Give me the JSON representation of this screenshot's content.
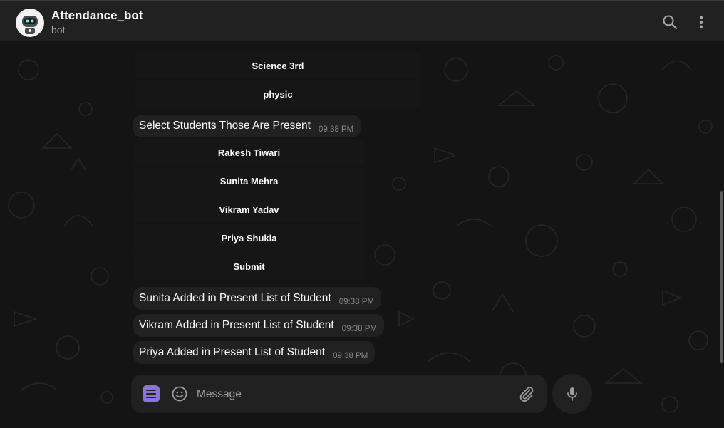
{
  "header": {
    "title": "Attendance_bot",
    "subtitle": "bot"
  },
  "chat": {
    "keyboard_top": [
      {
        "label": "Science 3rd"
      },
      {
        "label": "physic"
      }
    ],
    "prompt_message": {
      "text": "Select Students Those Are Present",
      "time": "09:38 PM"
    },
    "student_buttons": [
      {
        "label": "Rakesh Tiwari"
      },
      {
        "label": "Sunita Mehra"
      },
      {
        "label": "Vikram Yadav"
      },
      {
        "label": "Priya Shukla"
      },
      {
        "label": "Submit"
      }
    ],
    "messages": [
      {
        "text": "Sunita Added in Present List of Student",
        "time": "09:38 PM"
      },
      {
        "text": "Vikram Added in Present List of Student",
        "time": "09:38 PM"
      },
      {
        "text": "Priya Added in Present List of Student",
        "time": "09:38 PM"
      }
    ]
  },
  "composer": {
    "placeholder": "Message"
  },
  "icons": {
    "search": "search-icon",
    "more": "more-vertical-icon",
    "menu": "menu-icon",
    "emoji": "emoji-icon",
    "attach": "paperclip-icon",
    "mic": "microphone-icon"
  },
  "colors": {
    "accent": "#8774e1",
    "header_bg": "#212121",
    "bubble_bg": "#212121",
    "chat_bg": "#141414"
  }
}
